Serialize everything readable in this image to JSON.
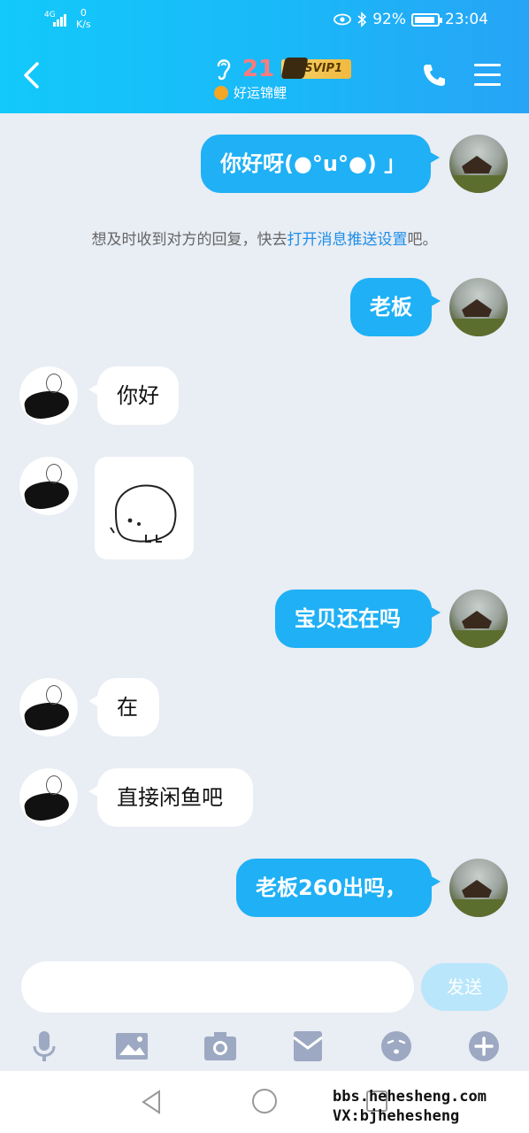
{
  "status_bar": {
    "network": "4G",
    "speed_value": "0",
    "speed_unit": "K/s",
    "battery": "92%",
    "battery_level": 0.92,
    "time": "23:04"
  },
  "header": {
    "level": "21",
    "vip_badge": "SVIP1",
    "nickname": "好运锦鲤"
  },
  "notice": {
    "prefix": "想及时收到对方的回复，快去",
    "link": "打开消息推送设置",
    "suffix": "吧。"
  },
  "messages": [
    {
      "from": "self",
      "text": "你好呀(●°u°●)​ 」"
    },
    {
      "from": "self",
      "text": "老板"
    },
    {
      "from": "other",
      "text": "你好"
    },
    {
      "from": "other",
      "type": "sticker"
    },
    {
      "from": "self",
      "text": "宝贝还在吗"
    },
    {
      "from": "other",
      "text": "在"
    },
    {
      "from": "other",
      "text": "直接闲鱼吧"
    },
    {
      "from": "self",
      "text": "老板260出吗，"
    }
  ],
  "input": {
    "placeholder": "",
    "send_label": "发送"
  },
  "toolbar": [
    "voice-icon",
    "image-icon",
    "camera-icon",
    "red-packet-icon",
    "emoji-icon",
    "plus-icon"
  ],
  "watermark": {
    "line1": "bbs.hehesheng.com",
    "line2": "VX:bjhehesheng"
  },
  "colors": {
    "header_start": "#12c9fb",
    "header_end": "#27a4f6",
    "self_bubble": "#1fb0f5",
    "background": "#e9edf4",
    "link": "#1e8ee8"
  }
}
